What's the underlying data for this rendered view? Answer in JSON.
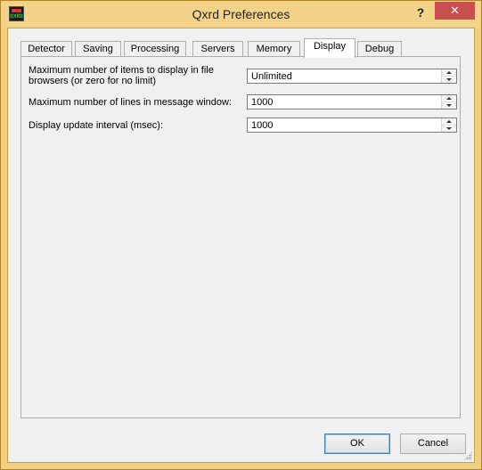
{
  "window": {
    "title": "Qxrd Preferences",
    "help_label": "?",
    "close_label": "✕",
    "icon_text": "QXRD"
  },
  "tabs": [
    {
      "label": "Detector",
      "active": false
    },
    {
      "label": "Saving",
      "active": false
    },
    {
      "label": "Processing",
      "active": false
    },
    {
      "label": "Servers",
      "active": false
    },
    {
      "label": "Memory",
      "active": false
    },
    {
      "label": "Display",
      "active": true
    },
    {
      "label": "Debug",
      "active": false
    }
  ],
  "display": {
    "max_items": {
      "label_line1": "Maximum number of items to display in file",
      "label_line2": "browsers (or zero for no limit)",
      "value": "Unlimited"
    },
    "max_lines": {
      "label": "Maximum number of lines in message window:",
      "value": "1000"
    },
    "update_interval": {
      "label": "Display update interval (msec):",
      "value": "1000"
    }
  },
  "buttons": {
    "ok": "OK",
    "cancel": "Cancel"
  },
  "colors": {
    "titlebar": "#f3d38a",
    "close_button": "#c74f4f",
    "dialog_bg": "#f0f0f0"
  },
  "icons": {
    "help": "question-mark-icon",
    "close": "close-icon",
    "spin_up": "triangle-up-icon",
    "spin_down": "triangle-down-icon"
  }
}
